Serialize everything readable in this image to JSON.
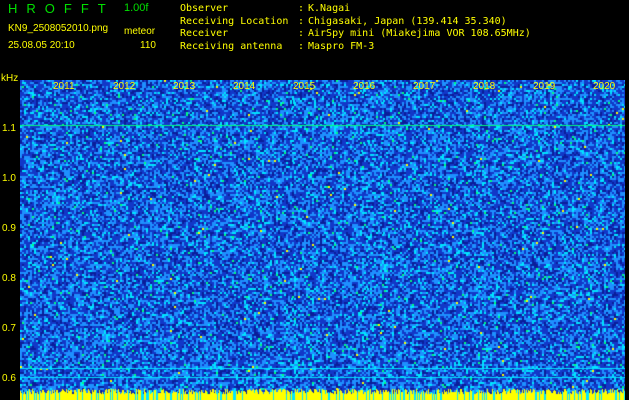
{
  "header": {
    "app_title": "HROFFT",
    "version": "1.00f",
    "filename": "KN9_2508052010.png",
    "mode": "meteor",
    "datetime": "25.08.05 20:10",
    "count": "110"
  },
  "station": {
    "labels": [
      "Observer",
      "Receiving Location",
      "Receiver",
      "Receiving antenna"
    ],
    "values": [
      "K.Nagai",
      "Chigasaki, Japan (139.414 35.340)",
      "AirSpy mini (Miakejima VOR 108.65MHz)",
      "Maspro FM-3"
    ]
  },
  "spectrogram": {
    "y_unit": "kHz",
    "y_ticks": [
      "1.1",
      "1.0",
      "0.9",
      "0.8",
      "0.7",
      "0.6"
    ],
    "x_ticks": [
      "2011",
      "2012",
      "2013",
      "2014",
      "2015",
      "2016",
      "2017",
      "2018",
      "2019",
      "2020"
    ],
    "colors": {
      "background": "#1238c8",
      "noise_low": "#0a1e9a",
      "noise_mid": "#1e90ff",
      "noise_high": "#00e5ff",
      "signal": "#00ff80",
      "peak": "#ffff00"
    }
  }
}
